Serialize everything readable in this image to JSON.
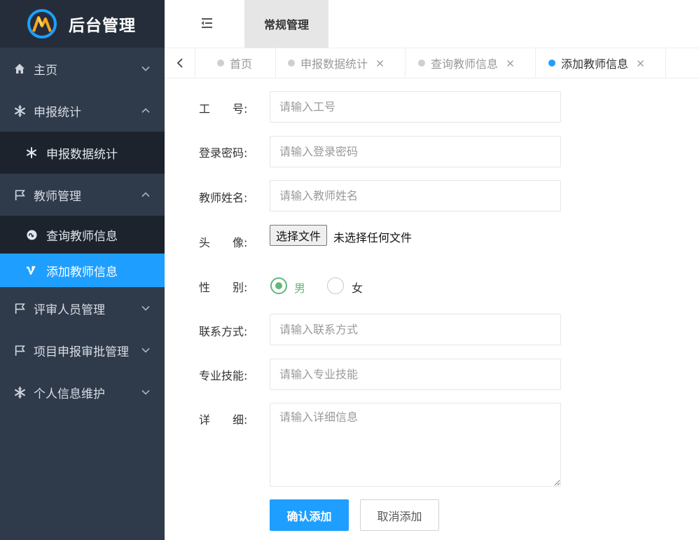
{
  "app": {
    "title": "后台管理"
  },
  "header": {
    "top_tab": "常规管理"
  },
  "sidebar": {
    "items": [
      {
        "label": "主页"
      },
      {
        "label": "申报统计",
        "sub": [
          {
            "label": "申报数据统计"
          }
        ]
      },
      {
        "label": "教师管理",
        "sub": [
          {
            "label": "查询教师信息"
          },
          {
            "label": "添加教师信息"
          }
        ]
      },
      {
        "label": "评审人员管理"
      },
      {
        "label": "项目申报审批管理"
      },
      {
        "label": "个人信息维护"
      }
    ]
  },
  "tabs": [
    {
      "label": "首页"
    },
    {
      "label": "申报数据统计"
    },
    {
      "label": "查询教师信息"
    },
    {
      "label": "添加教师信息",
      "active": true
    }
  ],
  "form": {
    "id": {
      "label": "工　　号:",
      "placeholder": "请输入工号"
    },
    "password": {
      "label": "登录密码:",
      "placeholder": "请输入登录密码"
    },
    "name": {
      "label": "教师姓名:",
      "placeholder": "请输入教师姓名"
    },
    "avatar": {
      "label": "头　　像:",
      "button": "选择文件",
      "status": "未选择任何文件"
    },
    "gender": {
      "label": "性　　别:",
      "options": [
        "男",
        "女"
      ],
      "selected": "男"
    },
    "contact": {
      "label": "联系方式:",
      "placeholder": "请输入联系方式"
    },
    "skills": {
      "label": "专业技能:",
      "placeholder": "请输入专业技能"
    },
    "detail": {
      "label": "详　　细:",
      "placeholder": "请输入详细信息"
    },
    "submit": "确认添加",
    "cancel": "取消添加"
  },
  "colors": {
    "accent": "#1e9fff",
    "sidebar": "#2f3a4a",
    "sidebar_dark": "#1d232d",
    "radio": "#5fb878"
  }
}
